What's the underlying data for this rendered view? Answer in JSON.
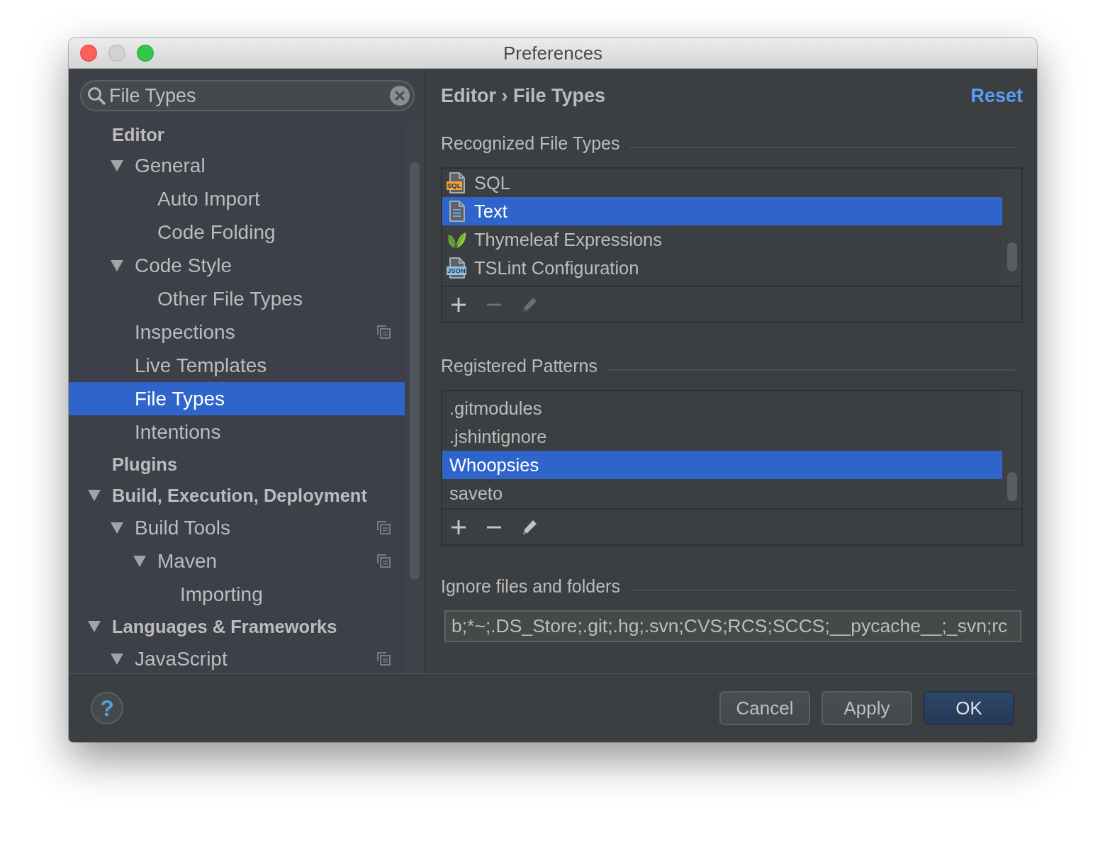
{
  "window": {
    "title": "Preferences",
    "controls": [
      {
        "kind": "close",
        "disabled": false
      },
      {
        "kind": "minimize",
        "disabled": true
      },
      {
        "kind": "zoom",
        "disabled": false
      }
    ]
  },
  "search": {
    "value": "File Types"
  },
  "sidebar": {
    "items": [
      {
        "label": "Editor",
        "selected": false,
        "children": [
          {
            "label": "General",
            "expanded": true,
            "selected": false,
            "children": [
              {
                "label": "Auto Import",
                "selected": false
              },
              {
                "label": "Code Folding",
                "selected": false
              }
            ]
          },
          {
            "label": "Code Style",
            "expanded": true,
            "selected": false,
            "children": [
              {
                "label": "Other File Types",
                "selected": false
              }
            ]
          },
          {
            "label": "Inspections",
            "selected": false,
            "project_level": true
          },
          {
            "label": "Live Templates",
            "selected": false
          },
          {
            "label": "File Types",
            "selected": true
          },
          {
            "label": "Intentions",
            "selected": false
          }
        ]
      },
      {
        "label": "Plugins",
        "selected": false
      },
      {
        "label": "Build, Execution, Deployment",
        "expanded": true,
        "selected": false,
        "children": [
          {
            "label": "Build Tools",
            "expanded": true,
            "selected": false,
            "project_level": true,
            "children": [
              {
                "label": "Maven",
                "expanded": true,
                "selected": false,
                "project_level": true,
                "children": [
                  {
                    "label": "Importing",
                    "selected": false
                  }
                ]
              }
            ]
          }
        ]
      },
      {
        "label": "Languages & Frameworks",
        "expanded": true,
        "selected": false,
        "children": [
          {
            "label": "JavaScript",
            "expanded": true,
            "selected": false,
            "project_level": true
          }
        ]
      }
    ]
  },
  "header": {
    "breadcrumb": "Editor › File Types",
    "reset": "Reset"
  },
  "recognized_file_types": {
    "title": "Recognized File Types",
    "rows": [
      {
        "label": "SQL",
        "kind": "badge-file",
        "badge": {
          "text": "SQL",
          "color": "#f2a33a"
        },
        "selected": false
      },
      {
        "label": "Text",
        "kind": "text-file",
        "selected": true
      },
      {
        "label": "Thymeleaf Expressions",
        "kind": "leaf",
        "selected": false
      },
      {
        "label": "TSLint Configuration",
        "kind": "badge-file",
        "badge": {
          "text": "JSON",
          "color": "#86c5ee"
        },
        "selected": false
      }
    ],
    "toolbar": [
      {
        "kind": "add",
        "disabled": false
      },
      {
        "kind": "remove",
        "disabled": true
      },
      {
        "kind": "edit",
        "disabled": true
      }
    ]
  },
  "registered_patterns": {
    "title": "Registered Patterns",
    "rows": [
      {
        "label": ".gitmodules",
        "selected": false
      },
      {
        "label": ".jshintignore",
        "selected": false
      },
      {
        "label": "Whoopsies",
        "selected": true
      },
      {
        "label": "saveto",
        "selected": false
      }
    ],
    "toolbar": [
      {
        "kind": "add",
        "disabled": false
      },
      {
        "kind": "remove",
        "disabled": false
      },
      {
        "kind": "edit",
        "disabled": false
      }
    ]
  },
  "ignore": {
    "title": "Ignore files and folders",
    "value": "b;*~;.DS_Store;.git;.hg;.svn;CVS;RCS;SCCS;__pycache__;_svn;rc"
  },
  "footer": {
    "help_button": {
      "label": "?"
    },
    "buttons": [
      {
        "label": "Cancel",
        "default": false
      },
      {
        "label": "Apply",
        "default": false
      },
      {
        "label": "OK",
        "default": true
      }
    ]
  }
}
